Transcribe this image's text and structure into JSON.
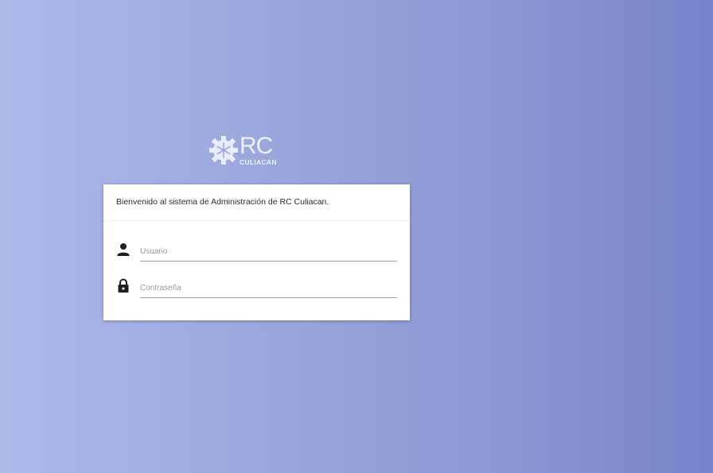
{
  "logo": {
    "main": "RC",
    "sub": "CULIACAN",
    "icon": "gear-snowflake-icon"
  },
  "card": {
    "welcome": "Bienvenido al sistema de Administración de RC Culiacan."
  },
  "fields": {
    "username": {
      "placeholder": "Usuario",
      "value": "",
      "icon": "person-icon"
    },
    "password": {
      "placeholder": "Contraseña",
      "value": "",
      "icon": "lock-icon"
    }
  },
  "colors": {
    "background_start": "#aeb8e9",
    "background_end": "#7783c9",
    "card": "#ffffff"
  }
}
